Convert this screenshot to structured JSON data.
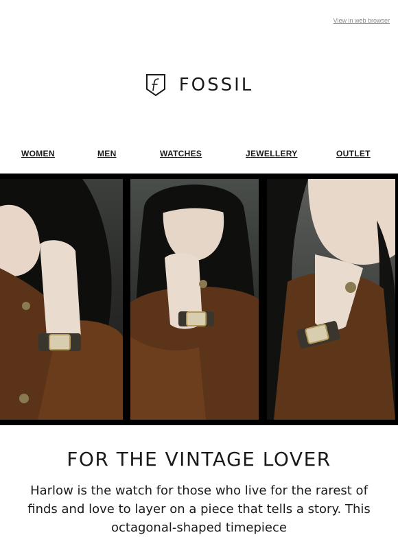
{
  "header": {
    "view_in_browser": "View in web browser",
    "logo_text": "FOSSIL"
  },
  "nav": {
    "items": [
      {
        "label": "WOMEN"
      },
      {
        "label": "MEN"
      },
      {
        "label": "WATCHES"
      },
      {
        "label": "JEWELLERY"
      },
      {
        "label": "OUTLET"
      }
    ]
  },
  "hero": {
    "panels": [
      "woman-wearing-watch-photo",
      "woman-wearing-watch-photo",
      "woman-wearing-watch-photo"
    ]
  },
  "content": {
    "headline": "FOR THE VINTAGE LOVER",
    "body": "Harlow is the watch for those who live for the rarest of finds and love to layer on a piece that tells a story. This octagonal-shaped timepiece"
  },
  "colors": {
    "text": "#1a1a1a",
    "background": "#ffffff",
    "hero_frame": "#000000"
  }
}
